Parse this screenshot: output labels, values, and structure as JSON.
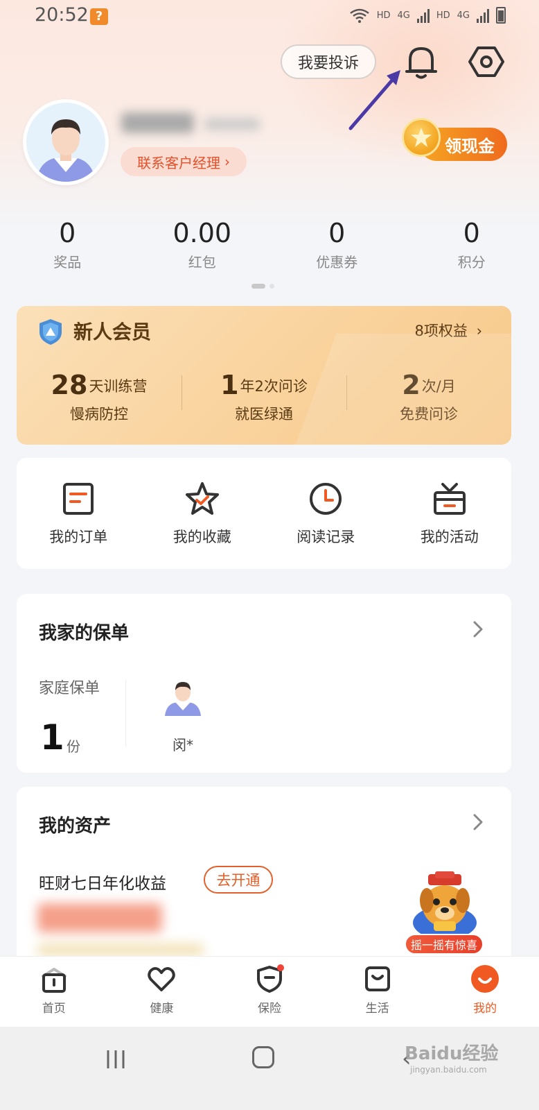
{
  "status_bar": {
    "time": "20:52",
    "app_icon_glyph": "?",
    "net1": "HD",
    "net1_gen": "4G",
    "net2": "HD",
    "net2_gen": "4G"
  },
  "header": {
    "complain_label": "我要投诉",
    "manager_label": "联系客户经理",
    "cash_label": "领现金"
  },
  "stats": [
    {
      "value": "0",
      "label": "奖品"
    },
    {
      "value": "0.00",
      "label": "红包"
    },
    {
      "value": "0",
      "label": "优惠券"
    },
    {
      "value": "0",
      "label": "积分"
    }
  ],
  "vip": {
    "title": "新人会员",
    "rights": "8项权益",
    "items": [
      {
        "num": "28",
        "unit": "天训练营",
        "sub": "慢病防控"
      },
      {
        "num": "1",
        "unit": "年2次问诊",
        "sub": "就医绿通"
      },
      {
        "num": "2",
        "unit": "次/月",
        "sub": "免费问诊"
      }
    ]
  },
  "actions": [
    {
      "label": "我的订单",
      "icon": "order-icon"
    },
    {
      "label": "我的收藏",
      "icon": "favorite-star-icon"
    },
    {
      "label": "阅读记录",
      "icon": "clock-icon"
    },
    {
      "label": "我的活动",
      "icon": "gift-icon"
    }
  ],
  "policy": {
    "title": "我家的保单",
    "family_label": "家庭保单",
    "count": "1",
    "unit": "份",
    "member_name": "闵*"
  },
  "assets": {
    "title": "我的资产",
    "label": "旺财七日年化收益",
    "open_label": "去开通"
  },
  "mascot": {
    "label": "摇一摇有惊喜"
  },
  "tabs": [
    {
      "label": "首页",
      "icon": "home-icon"
    },
    {
      "label": "健康",
      "icon": "heart-icon"
    },
    {
      "label": "保险",
      "icon": "shield-icon"
    },
    {
      "label": "生活",
      "icon": "bag-icon"
    },
    {
      "label": "我的",
      "icon": "profile-icon"
    }
  ],
  "watermark": {
    "text": "Baidu经验",
    "sub": "jingyan.baidu.com"
  },
  "colors": {
    "accent": "#f05a22",
    "vip_text": "#5a3a13",
    "icon_dark": "#333333",
    "annotation_arrow": "#4b3aa6"
  }
}
